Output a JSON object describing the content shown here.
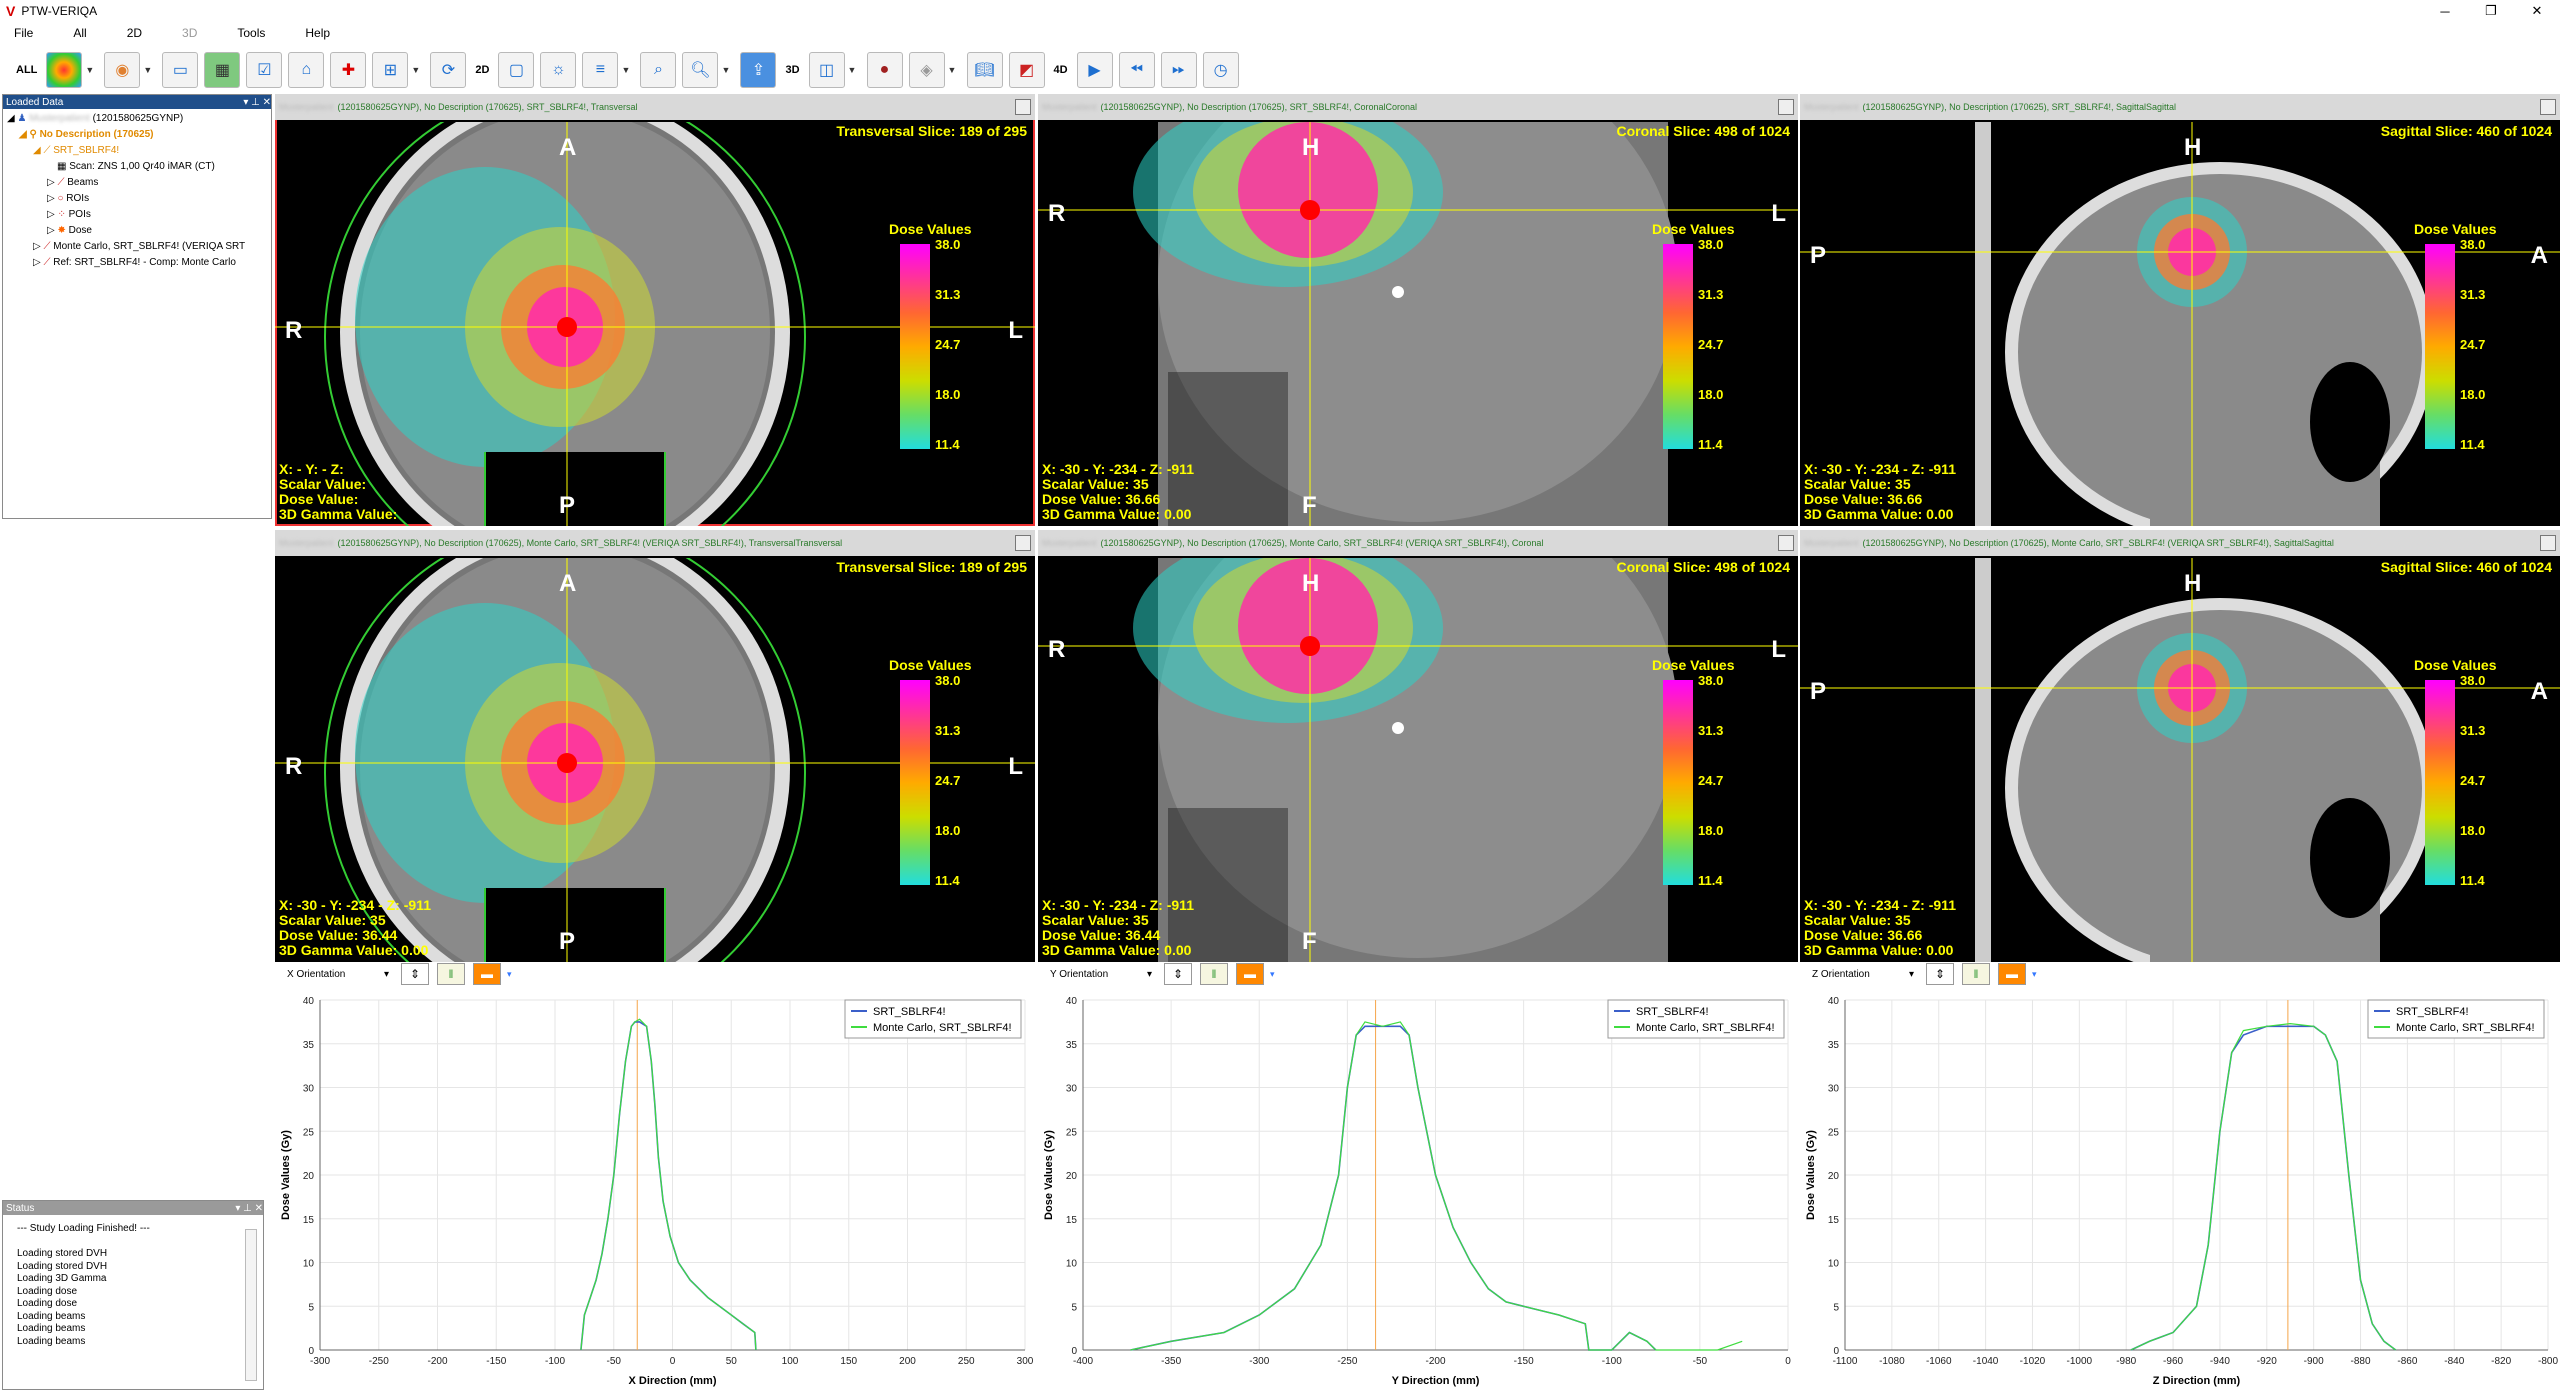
{
  "app": {
    "title": "PTW-VERIQA",
    "logo": "V"
  },
  "menu": [
    "File",
    "All",
    "2D",
    "3D",
    "Tools",
    "Help"
  ],
  "toolbar": {
    "all_label": "ALL",
    "label_2d": "2D",
    "label_3d": "3D",
    "label_4d": "4D"
  },
  "loaded_data": {
    "title": "Loaded Data",
    "patient_id": "(1201580625GYNP)",
    "study": "No Description (170625)",
    "plan": "SRT_SBLRF4!",
    "scan": "Scan: ZNS 1,00 Qr40 iMAR (CT)",
    "beams": "Beams",
    "rois": "ROIs",
    "pois": "POIs",
    "dose": "Dose",
    "mc": "Monte Carlo, SRT_SBLRF4! (VERIQA SRT",
    "ref": "Ref: SRT_SBLRF4!  - Comp: Monte Carlo"
  },
  "status": {
    "title": "Status",
    "lines": [
      "--- Study Loading Finished! ---",
      "",
      "Loading stored DVH",
      "Loading stored DVH",
      "Loading 3D Gamma",
      "Loading dose",
      "Loading dose",
      "Loading beams",
      "Loading beams",
      "Loading beams"
    ]
  },
  "viewers": [
    {
      "header": "(1201580625GYNP), No Description (170625), SRT_SBLRF4!, Transversal",
      "slice": "Transversal Slice: 189 of 295",
      "top": "A",
      "bottom": "P",
      "left": "R",
      "right": "L",
      "info": [
        "X: - Y: - Z:",
        "Scalar Value:",
        "Dose Value:",
        "3D Gamma Value:"
      ],
      "dose_title": "Dose Values",
      "ticks": [
        "38.0",
        "31.3",
        "24.7",
        "18.0",
        "11.4"
      ]
    },
    {
      "header": "(1201580625GYNP), No Description (170625), SRT_SBLRF4!, CoronalCoronal",
      "slice": "Coronal Slice: 498 of 1024",
      "top": "H",
      "bottom": "F",
      "left": "R",
      "right": "L",
      "info": [
        "X: -30 - Y: -234 - Z: -911",
        "Scalar Value: 35",
        "Dose Value: 36.66",
        "3D Gamma Value: 0.00"
      ],
      "dose_title": "Dose Values",
      "ticks": [
        "38.0",
        "31.3",
        "24.7",
        "18.0",
        "11.4"
      ]
    },
    {
      "header": "(1201580625GYNP), No Description (170625), SRT_SBLRF4!, SagittalSagittal",
      "slice": "Sagittal Slice: 460 of 1024",
      "top": "H",
      "bottom": "",
      "left": "P",
      "right": "A",
      "info": [
        "X: -30 - Y: -234 - Z: -911",
        "Scalar Value: 35",
        "Dose Value: 36.66",
        "3D Gamma Value: 0.00"
      ],
      "dose_title": "Dose Values",
      "ticks": [
        "38.0",
        "31.3",
        "24.7",
        "18.0",
        "11.4"
      ]
    },
    {
      "header": "(1201580625GYNP), No Description (170625), Monte Carlo, SRT_SBLRF4! (VERIQA SRT_SBLRF4!), TransversalTransversal",
      "slice": "Transversal Slice: 189 of 295",
      "top": "A",
      "bottom": "P",
      "left": "R",
      "right": "L",
      "info": [
        "X: -30 - Y: -234 - Z: -911",
        "Scalar Value: 35",
        "Dose Value: 36.44",
        "3D Gamma Value: 0.00"
      ],
      "dose_title": "Dose Values",
      "ticks": [
        "38.0",
        "31.3",
        "24.7",
        "18.0",
        "11.4"
      ]
    },
    {
      "header": "(1201580625GYNP), No Description (170625), Monte Carlo, SRT_SBLRF4! (VERIQA SRT_SBLRF4!), Coronal",
      "slice": "Coronal Slice: 498 of 1024",
      "top": "H",
      "bottom": "F",
      "left": "R",
      "right": "L",
      "info": [
        "X: -30 - Y: -234 - Z: -911",
        "Scalar Value: 35",
        "Dose Value: 36.44",
        "3D Gamma Value: 0.00"
      ],
      "dose_title": "Dose Values",
      "ticks": [
        "38.0",
        "31.3",
        "24.7",
        "18.0",
        "11.4"
      ]
    },
    {
      "header": "(1201580625GYNP), No Description (170625), Monte Carlo, SRT_SBLRF4! (VERIQA SRT_SBLRF4!), SagittalSagittal",
      "slice": "Sagittal Slice: 460 of 1024",
      "top": "H",
      "bottom": "",
      "left": "P",
      "right": "A",
      "info": [
        "X: -30 - Y: -234 - Z: -911",
        "Scalar Value: 35",
        "Dose Value: 36.66",
        "3D Gamma Value: 0.00"
      ],
      "dose_title": "Dose Values",
      "ticks": [
        "38.0",
        "31.3",
        "24.7",
        "18.0",
        "11.4"
      ]
    }
  ],
  "profiles": [
    {
      "orientation": "X Orientation",
      "xlabel": "X Direction (mm)"
    },
    {
      "orientation": "Y Orientation",
      "xlabel": "Y Direction (mm)"
    },
    {
      "orientation": "Z Orientation",
      "xlabel": "Z Direction (mm)"
    }
  ],
  "chart_data": [
    {
      "type": "line",
      "title": "",
      "xlabel": "X Direction (mm)",
      "ylabel": "Dose Values (Gy)",
      "xlim": [
        -300,
        300
      ],
      "ylim": [
        0,
        40
      ],
      "xticks": [
        -300,
        -250,
        -200,
        -150,
        -100,
        -50,
        0,
        50,
        100,
        150,
        200,
        250,
        300
      ],
      "yticks": [
        0,
        5,
        10,
        15,
        20,
        25,
        30,
        35,
        40
      ],
      "legend": "top-right",
      "marker_x": -30,
      "series": [
        {
          "name": "SRT_SBLRF4!",
          "color": "#3b5fc9",
          "x": [
            -78,
            -75,
            -70,
            -65,
            -60,
            -55,
            -50,
            -45,
            -40,
            -35,
            -32,
            -28,
            -22,
            -18,
            -15,
            -12,
            -8,
            -2,
            5,
            15,
            30,
            50,
            60,
            70,
            71
          ],
          "y": [
            0,
            4,
            6,
            8,
            11,
            15,
            20,
            27,
            33,
            37,
            37.5,
            37.5,
            37,
            33,
            28,
            22,
            17,
            13,
            10,
            8,
            6,
            4,
            3,
            2,
            0
          ]
        },
        {
          "name": "Monte Carlo, SRT_SBLRF4!",
          "color": "#3fdc3f",
          "x": [
            -78,
            -75,
            -70,
            -65,
            -60,
            -55,
            -50,
            -45,
            -40,
            -35,
            -32,
            -28,
            -22,
            -18,
            -15,
            -12,
            -8,
            -2,
            5,
            15,
            30,
            50,
            60,
            70,
            71
          ],
          "y": [
            0,
            4,
            6,
            8,
            11,
            15,
            20,
            27,
            33,
            37,
            37.5,
            37.8,
            37,
            33,
            28,
            22,
            17,
            13,
            10,
            8,
            6,
            4,
            3,
            2,
            0
          ]
        }
      ]
    },
    {
      "type": "line",
      "title": "",
      "xlabel": "Y Direction (mm)",
      "ylabel": "Dose Values (Gy)",
      "xlim": [
        -400,
        0
      ],
      "ylim": [
        0,
        40
      ],
      "xticks": [
        -400,
        -350,
        -300,
        -250,
        -200,
        -150,
        -100,
        -50,
        0
      ],
      "yticks": [
        0,
        5,
        10,
        15,
        20,
        25,
        30,
        35,
        40
      ],
      "legend": "top-right",
      "marker_x": -234,
      "series": [
        {
          "name": "SRT_SBLRF4!",
          "color": "#3b5fc9",
          "x": [
            -373,
            -350,
            -320,
            -300,
            -280,
            -265,
            -255,
            -250,
            -245,
            -240,
            -230,
            -220,
            -215,
            -210,
            -200,
            -190,
            -180,
            -170,
            -160,
            -150,
            -130,
            -115,
            -113,
            -100,
            -90,
            -80,
            -75
          ],
          "y": [
            0,
            1,
            2,
            4,
            7,
            12,
            20,
            30,
            36,
            37,
            37,
            37,
            36,
            30,
            20,
            14,
            10,
            7,
            5.5,
            5,
            4,
            3,
            0,
            0,
            2,
            1,
            0
          ]
        },
        {
          "name": "Monte Carlo, SRT_SBLRF4!",
          "color": "#3fdc3f",
          "x": [
            -373,
            -350,
            -320,
            -300,
            -280,
            -265,
            -255,
            -250,
            -245,
            -240,
            -230,
            -220,
            -215,
            -210,
            -200,
            -190,
            -180,
            -170,
            -160,
            -150,
            -130,
            -115,
            -113,
            -100,
            -90,
            -80,
            -75,
            -40,
            -26
          ],
          "y": [
            0,
            1,
            2,
            4,
            7,
            12,
            20,
            30,
            36,
            37.5,
            37,
            37.5,
            36,
            30,
            20,
            14,
            10,
            7,
            5.5,
            5,
            4,
            3,
            0,
            0,
            2,
            1,
            0,
            0,
            1
          ]
        }
      ]
    },
    {
      "type": "line",
      "title": "",
      "xlabel": "Z Direction (mm)",
      "ylabel": "Dose Values (Gy)",
      "xlim": [
        -1100,
        -800
      ],
      "ylim": [
        0,
        40
      ],
      "xticks": [
        -1100,
        -1080,
        -1060,
        -1040,
        -1020,
        -1000,
        -980,
        -960,
        -940,
        -920,
        -900,
        -880,
        -860,
        -840,
        -820,
        -800
      ],
      "yticks": [
        0,
        5,
        10,
        15,
        20,
        25,
        30,
        35,
        40
      ],
      "legend": "top-right",
      "marker_x": -911,
      "series": [
        {
          "name": "SRT_SBLRF4!",
          "color": "#3b5fc9",
          "x": [
            -978,
            -970,
            -960,
            -950,
            -945,
            -940,
            -935,
            -930,
            -920,
            -910,
            -900,
            -895,
            -890,
            -885,
            -880,
            -875,
            -870,
            -865
          ],
          "y": [
            0,
            1,
            2,
            5,
            12,
            25,
            34,
            36,
            37,
            37,
            37,
            36,
            33,
            20,
            8,
            3,
            1,
            0
          ]
        },
        {
          "name": "Monte Carlo, SRT_SBLRF4!",
          "color": "#3fdc3f",
          "x": [
            -978,
            -970,
            -960,
            -950,
            -945,
            -940,
            -935,
            -930,
            -920,
            -910,
            -900,
            -895,
            -890,
            -885,
            -880,
            -875,
            -870,
            -865
          ],
          "y": [
            0,
            1,
            2,
            5,
            12,
            25,
            34,
            36.5,
            37,
            37.3,
            37,
            36,
            33,
            20,
            8,
            3,
            1,
            0
          ]
        }
      ]
    }
  ]
}
